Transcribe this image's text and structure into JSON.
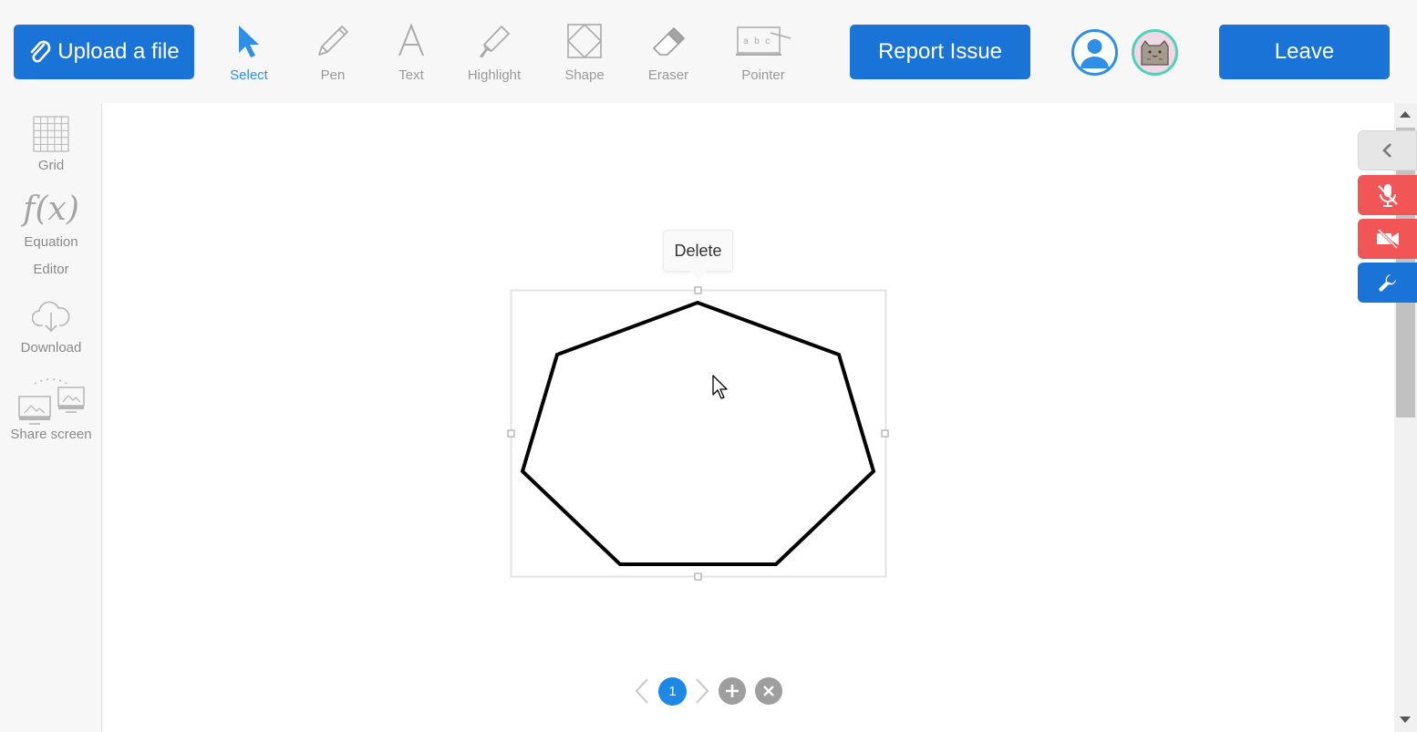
{
  "toolbar": {
    "upload_label": "Upload a file",
    "tools": [
      {
        "name": "select",
        "label": "Select"
      },
      {
        "name": "pen",
        "label": "Pen"
      },
      {
        "name": "text",
        "label": "Text"
      },
      {
        "name": "highlight",
        "label": "Highlight"
      },
      {
        "name": "shape",
        "label": "Shape"
      },
      {
        "name": "eraser",
        "label": "Eraser"
      },
      {
        "name": "pointer",
        "label": "Pointer",
        "icon_text": "a b c"
      }
    ],
    "active_tool": "Select",
    "report_label": "Report Issue",
    "leave_label": "Leave"
  },
  "sidebar": {
    "grid_label": "Grid",
    "equation_icon": "f(x)",
    "equation_label_line1": "Equation",
    "equation_label_line2": "Editor",
    "download_label": "Download",
    "share_label": "Share screen"
  },
  "canvas": {
    "delete_label": "Delete",
    "selected_shape": "heptagon"
  },
  "pager": {
    "current_page": "1"
  },
  "right_panel": {
    "icons": [
      "chevron-left-icon",
      "mic-off-icon",
      "camera-off-icon",
      "wrench-icon"
    ]
  },
  "colors": {
    "accent": "#1a73d6",
    "active_tool": "#2f8ee6",
    "muted_red": "#f25555",
    "page_badge": "#1e88e5"
  }
}
